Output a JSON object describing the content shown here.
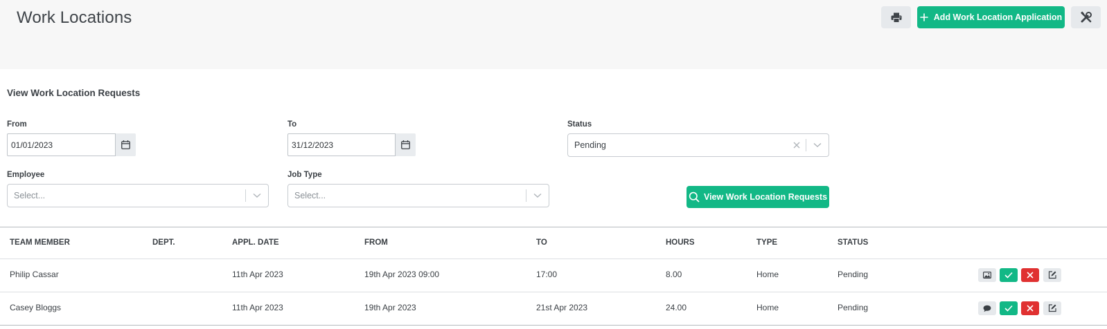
{
  "header": {
    "title": "Work Locations",
    "add_button_label": "Add Work Location Application"
  },
  "filters": {
    "section_title": "View Work Location Requests",
    "from_label": "From",
    "from_value": "01/01/2023",
    "to_label": "To",
    "to_value": "31/12/2023",
    "status_label": "Status",
    "status_value": "Pending",
    "employee_label": "Employee",
    "employee_placeholder": "Select...",
    "job_type_label": "Job Type",
    "job_type_placeholder": "Select...",
    "view_button_label": "View Work Location Requests"
  },
  "table": {
    "columns": [
      "TEAM MEMBER",
      "DEPT.",
      "APPL. DATE",
      "FROM",
      "TO",
      "HOURS",
      "TYPE",
      "STATUS"
    ],
    "rows": [
      {
        "team_member": "Philip Cassar",
        "dept": "",
        "appl_date": "11th Apr 2023",
        "from": "19th Apr 2023 09:00",
        "to": "17:00",
        "hours": "8.00",
        "type": "Home",
        "status": "Pending",
        "first_action_icon": "image-icon"
      },
      {
        "team_member": "Casey Bloggs",
        "dept": "",
        "appl_date": "11th Apr 2023",
        "from": "19th Apr 2023",
        "to": "21st Apr 2023",
        "hours": "24.00",
        "type": "Home",
        "status": "Pending",
        "first_action_icon": "comment-icon"
      }
    ]
  },
  "colors": {
    "accent": "#12b886",
    "danger": "#e03131",
    "header_bg": "#f7f7f7"
  }
}
